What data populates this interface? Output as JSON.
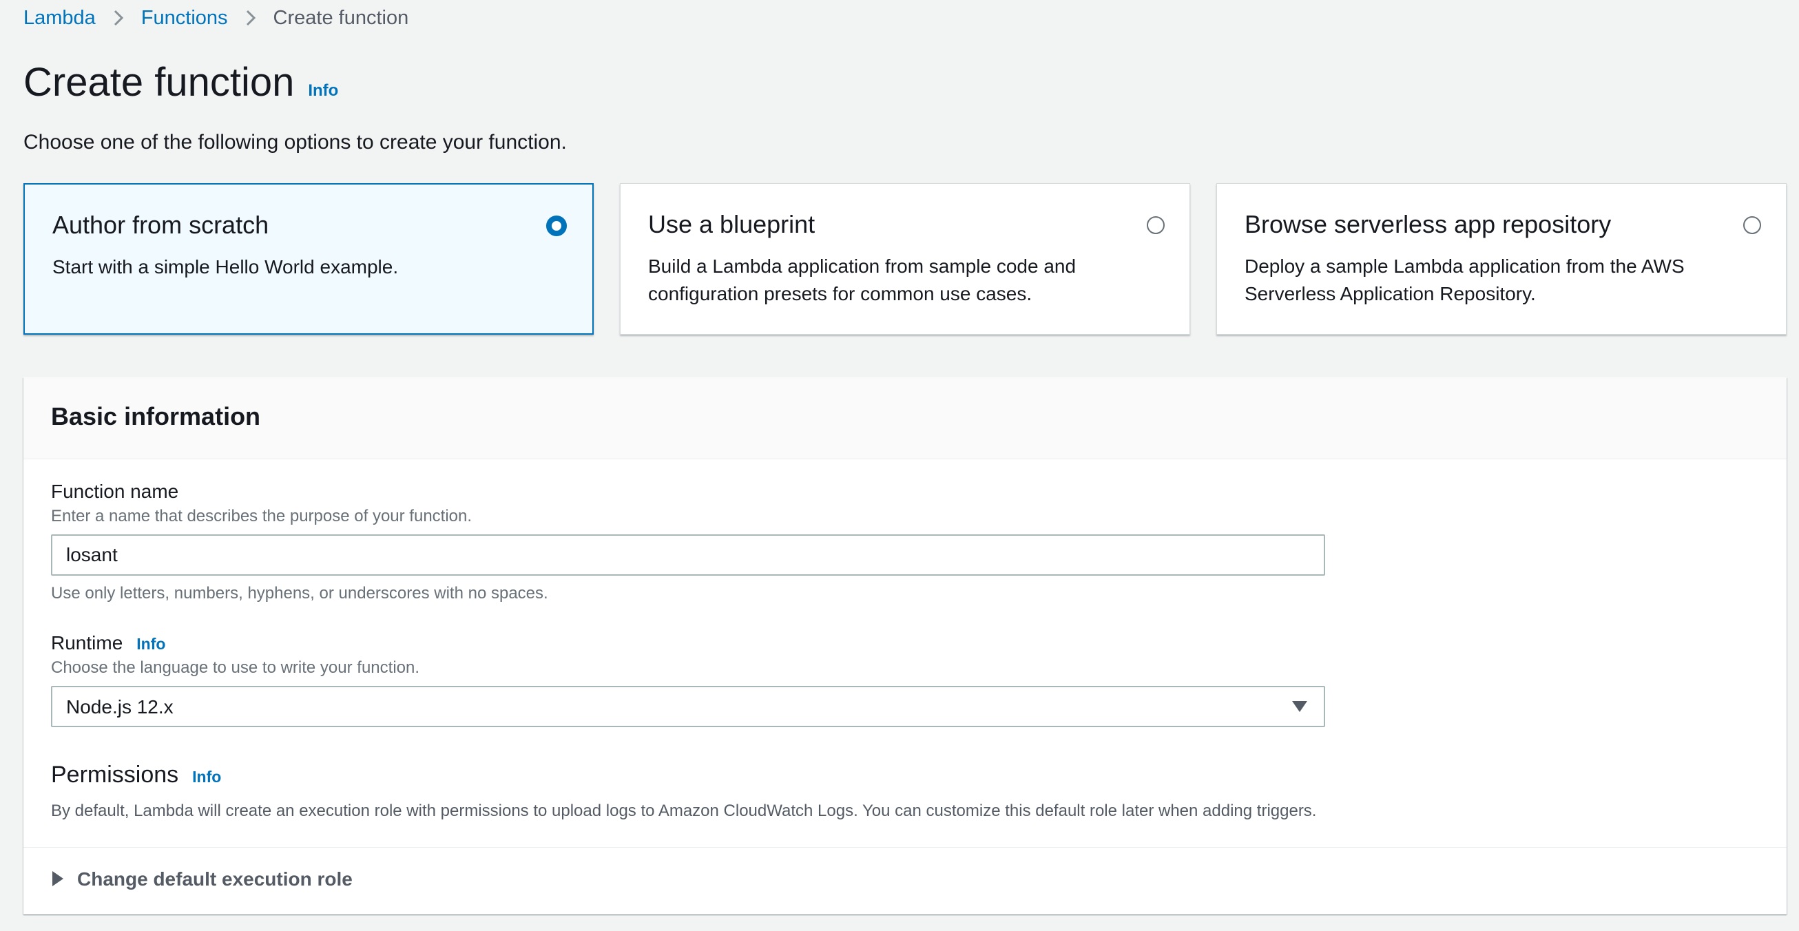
{
  "breadcrumb": {
    "items": [
      "Lambda",
      "Functions"
    ],
    "current": "Create function"
  },
  "page": {
    "title": "Create function",
    "info": "Info",
    "subtitle": "Choose one of the following options to create your function."
  },
  "options": [
    {
      "title": "Author from scratch",
      "description": "Start with a simple Hello World example.",
      "selected": true
    },
    {
      "title": "Use a blueprint",
      "description": "Build a Lambda application from sample code and configuration presets for common use cases.",
      "selected": false
    },
    {
      "title": "Browse serverless app repository",
      "description": "Deploy a sample Lambda application from the AWS Serverless Application Repository.",
      "selected": false
    }
  ],
  "basic_info": {
    "title": "Basic information",
    "function_name": {
      "label": "Function name",
      "description": "Enter a name that describes the purpose of your function.",
      "value": "losant",
      "constraint": "Use only letters, numbers, hyphens, or underscores with no spaces."
    },
    "runtime": {
      "label": "Runtime",
      "info": "Info",
      "description": "Choose the language to use to write your function.",
      "value": "Node.js 12.x"
    },
    "permissions": {
      "title": "Permissions",
      "info": "Info",
      "description": "By default, Lambda will create an execution role with permissions to upload logs to Amazon CloudWatch Logs. You can customize this default role later when adding triggers.",
      "expander_label": "Change default execution role",
      "expanded": false
    }
  },
  "colors": {
    "link": "#0073bb",
    "selected_border": "#0073bb",
    "selected_bg": "#f1faff",
    "page_bg": "#f2f3f3"
  },
  "icons": {
    "breadcrumb_separator": "chevron-right-icon",
    "select_caret": "caret-down-icon",
    "expander": "caret-right-icon"
  }
}
